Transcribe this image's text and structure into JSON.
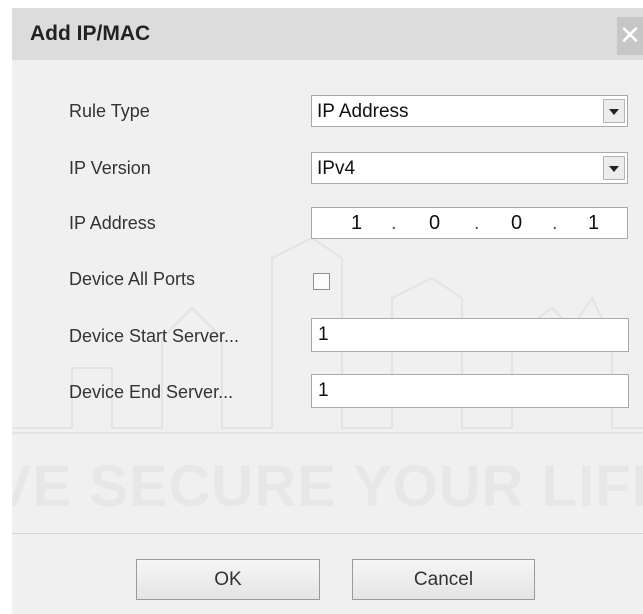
{
  "dialog": {
    "title": "Add IP/MAC",
    "close_glyph": "✕",
    "watermark_text": "VE SECURE YOUR LIFE"
  },
  "form": {
    "rule_type": {
      "label": "Rule Type",
      "value": "IP Address"
    },
    "ip_version": {
      "label": "IP Version",
      "value": "IPv4"
    },
    "ip_address": {
      "label": "IP Address",
      "octets": [
        "1",
        "0",
        "0",
        "1"
      ]
    },
    "device_all_ports": {
      "label": "Device All Ports",
      "checked": false
    },
    "device_start_server": {
      "label": "Device Start Server...",
      "value": "1"
    },
    "device_end_server": {
      "label": "Device End Server...",
      "value": "1"
    }
  },
  "buttons": {
    "ok": "OK",
    "cancel": "Cancel"
  }
}
